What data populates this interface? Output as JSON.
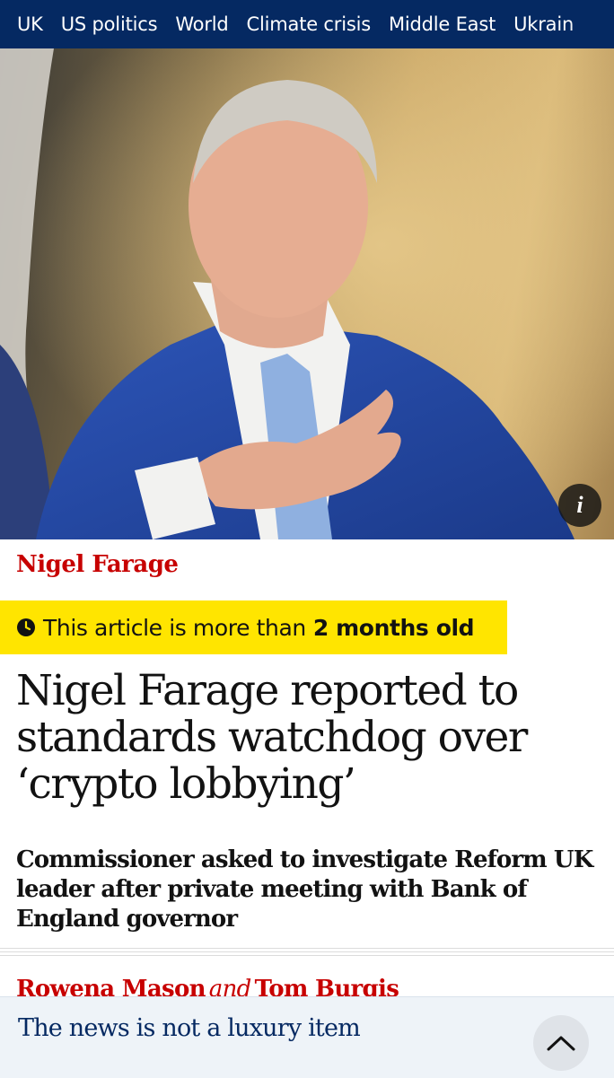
{
  "nav": {
    "items": [
      "UK",
      "US politics",
      "World",
      "Climate crisis",
      "Middle East",
      "Ukrain"
    ]
  },
  "hero": {
    "info_icon": "info-icon",
    "info_glyph": "i"
  },
  "article": {
    "section": "Nigel Farage",
    "age_warning": {
      "icon": "clock-icon",
      "prefix": "This article is more than",
      "emphasis": "2 months old"
    },
    "headline": "Nigel Farage reported to standards watchdog over ‘crypto lobbying’",
    "standfirst": "Commissioner asked to investigate Reform UK leader after private meeting with Bank of England governor",
    "byline": {
      "author1": "Rowena Mason",
      "joiner": "and",
      "author2": "Tom Burgis"
    }
  },
  "banner": {
    "text": "The news is not a luxury item",
    "expand_icon": "chevron-up-icon"
  },
  "colors": {
    "nav_bg": "#052962",
    "section_red": "#c70000",
    "warning_yellow": "#ffe500",
    "banner_bg": "#eef3f8"
  }
}
